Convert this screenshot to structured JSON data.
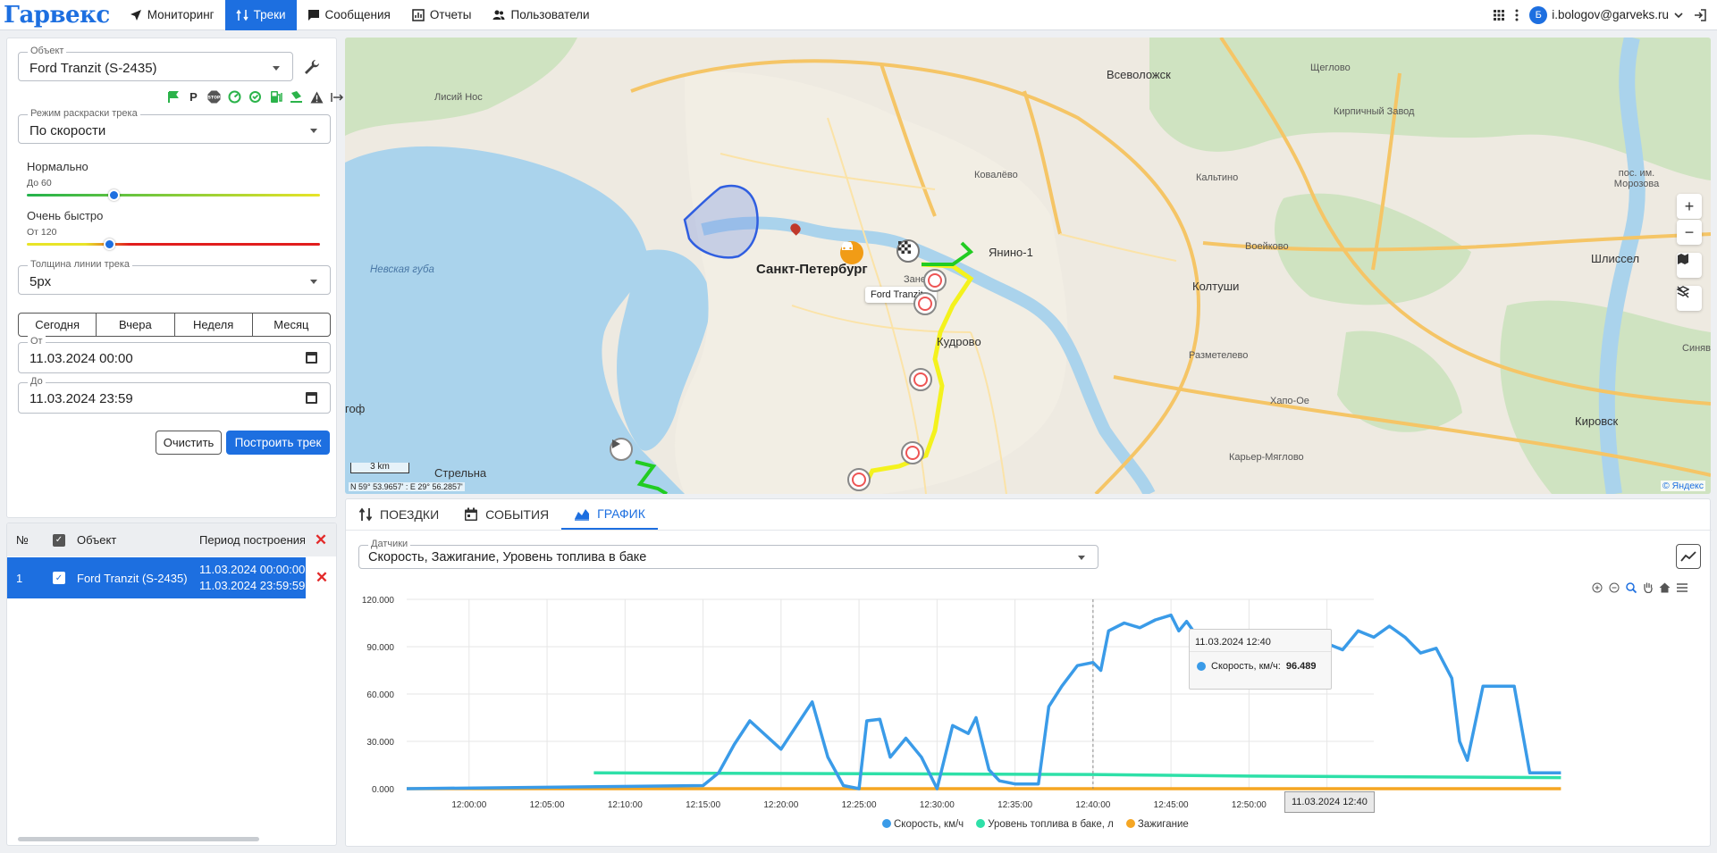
{
  "app": {
    "logo": "Гарвекс"
  },
  "nav": {
    "items": [
      {
        "label": "Мониторинг",
        "icon": "navigation-icon",
        "active": false
      },
      {
        "label": "Треки",
        "icon": "route-icon",
        "active": true
      },
      {
        "label": "Сообщения",
        "icon": "message-icon",
        "active": false
      },
      {
        "label": "Отчеты",
        "icon": "chart-icon",
        "active": false
      },
      {
        "label": "Пользователи",
        "icon": "users-icon",
        "active": false
      }
    ],
    "user_initial": "Б",
    "user_email": "i.bologov@garveks.ru"
  },
  "filters": {
    "object_legend": "Объект",
    "object_value": "Ford Tranzit (S-2435)",
    "color_mode_legend": "Режим раскраски трека",
    "color_mode_value": "По скорости",
    "normal_label": "Нормально",
    "normal_sub": "До 60",
    "normal_value": 60,
    "fast_label": "Очень быстро",
    "fast_sub": "От 120",
    "fast_value": 120,
    "thickness_legend": "Толщина линии трека",
    "thickness_value": "5px",
    "periods": [
      "Сегодня",
      "Вчера",
      "Неделя",
      "Месяц"
    ],
    "from_legend": "От",
    "from_value": "11.03.2024 00:00",
    "to_legend": "До",
    "to_value": "11.03.2024 23:59",
    "clear_label": "Очистить",
    "build_label": "Построить трек"
  },
  "tracks_table": {
    "headers": [
      "№",
      "Объект",
      "Период построения"
    ],
    "rows": [
      {
        "num": "1",
        "object": "Ford Tranzit (S-2435)",
        "from": "11.03.2024 00:00:00",
        "to": "11.03.2024 23:59:59"
      }
    ]
  },
  "map": {
    "labels": {
      "spb": "Санкт-Петербург",
      "vsevolozhsk": "Всеволожск",
      "yanino": "Янино-1",
      "koltushi": "Колтуши",
      "kudrovo": "Кудрово",
      "kirovsk": "Кировск",
      "shlisselburg": "Шлиссел",
      "morozova": "пос. им. Морозова",
      "neva_bay": "Невская губа",
      "strelna": "Стрельна",
      "lisiy_nos": "Лисий Нос",
      "kovalevo": "Ковалёво",
      "kaltino": "Кальтино",
      "voeikovo": "Воейково",
      "razmetelevo": "Разметелево",
      "khapo_oe": "Хапо-Ое",
      "karyer": "Карьер-Мяглово",
      "shcheglovo": "Щеглово",
      "kirpichny": "Кирпичный Завод",
      "sinyavino": "Синяв",
      "zanevka": "Заневка",
      "petergof": "гоф"
    },
    "car_label": "Ford Tranzit...",
    "scale": "3 km",
    "coords": "N 59° 53.9657' : E 29° 56.2857'",
    "attribution": "© Яндекс",
    "zoom_in": "+",
    "zoom_out": "−"
  },
  "tabs": [
    {
      "label": "Поездки",
      "icon": "route-icon",
      "active": false
    },
    {
      "label": "События",
      "icon": "calendar-icon",
      "active": false
    },
    {
      "label": "График",
      "icon": "area-chart-icon",
      "active": true
    }
  ],
  "sensors": {
    "legend": "Датчики",
    "value": "Скорость, Зажигание, Уровень топлива в баке"
  },
  "tooltip": {
    "title": "11.03.2024 12:40",
    "series": "Скорость, км/ч:",
    "value": "96.489"
  },
  "crosshair_label": "11.03.2024 12:40",
  "chart_data": {
    "type": "line",
    "x_ticks": [
      "12:00:00",
      "12:05:00",
      "12:10:00",
      "12:15:00",
      "12:20:00",
      "12:25:00",
      "12:30:00",
      "12:35:00",
      "12:40:00",
      "12:45:00",
      "12:50:00",
      "12:55:00"
    ],
    "y_ticks": [
      "0.000",
      "30.000",
      "60.000",
      "90.000",
      "120.000"
    ],
    "ylim": [
      0,
      120
    ],
    "xlim": [
      "11:56",
      "12:58"
    ],
    "series": [
      {
        "name": "Скорость, км/ч",
        "color": "#3a9be8",
        "points": [
          [
            "11:56",
            0
          ],
          [
            "12:15",
            2
          ],
          [
            "12:16",
            10
          ],
          [
            "12:17",
            28
          ],
          [
            "12:18",
            43
          ],
          [
            "12:20",
            25
          ],
          [
            "12:22",
            55
          ],
          [
            "12:23",
            20
          ],
          [
            "12:24",
            2
          ],
          [
            "12:25",
            0
          ],
          [
            "12:25:30",
            43
          ],
          [
            "12:26:20",
            44
          ],
          [
            "12:27",
            20
          ],
          [
            "12:28",
            32
          ],
          [
            "12:29",
            20
          ],
          [
            "12:30",
            0
          ],
          [
            "12:31",
            40
          ],
          [
            "12:32",
            35
          ],
          [
            "12:32:30",
            45
          ],
          [
            "12:33:20",
            12
          ],
          [
            "12:34",
            5
          ],
          [
            "12:35",
            3
          ],
          [
            "12:36",
            3
          ],
          [
            "12:36:30",
            3
          ],
          [
            "12:37:10",
            52
          ],
          [
            "12:38",
            65
          ],
          [
            "12:39",
            78
          ],
          [
            "12:40",
            80
          ],
          [
            "12:40:30",
            75
          ],
          [
            "12:41",
            100
          ],
          [
            "12:42",
            105
          ],
          [
            "12:43",
            102
          ],
          [
            "12:44",
            107
          ],
          [
            "12:45",
            110
          ],
          [
            "12:45:30",
            100
          ],
          [
            "12:46",
            106
          ],
          [
            "12:47",
            92
          ],
          [
            "12:48",
            96
          ],
          [
            "12:49",
            90
          ],
          [
            "12:50",
            92
          ],
          [
            "12:50:30",
            96.5
          ],
          [
            "12:51",
            88
          ],
          [
            "12:52",
            82
          ],
          [
            "12:53",
            88
          ],
          [
            "12:54",
            85
          ],
          [
            "12:55",
            92
          ],
          [
            "12:56",
            88
          ],
          [
            "12:57",
            100
          ],
          [
            "12:58",
            96
          ],
          [
            "12:59",
            103
          ],
          [
            "13:00",
            96
          ],
          [
            "13:01",
            86
          ],
          [
            "13:02",
            89
          ],
          [
            "13:03",
            70
          ],
          [
            "13:03:30",
            30
          ],
          [
            "13:04",
            18
          ],
          [
            "13:05",
            65
          ],
          [
            "13:07",
            65
          ],
          [
            "13:08",
            10
          ],
          [
            "13:10",
            10
          ]
        ]
      },
      {
        "name": "Уровень топлива в баке, л",
        "color": "#2ee0a8",
        "points": [
          [
            "12:08",
            10
          ],
          [
            "12:40",
            9
          ],
          [
            "12:50",
            8
          ],
          [
            "13:10",
            7
          ]
        ]
      },
      {
        "name": "Зажигание",
        "color": "#f5a623",
        "points": [
          [
            "11:56",
            0
          ],
          [
            "13:10",
            0
          ]
        ]
      }
    ],
    "grid": true,
    "legend_position": "bottom"
  }
}
